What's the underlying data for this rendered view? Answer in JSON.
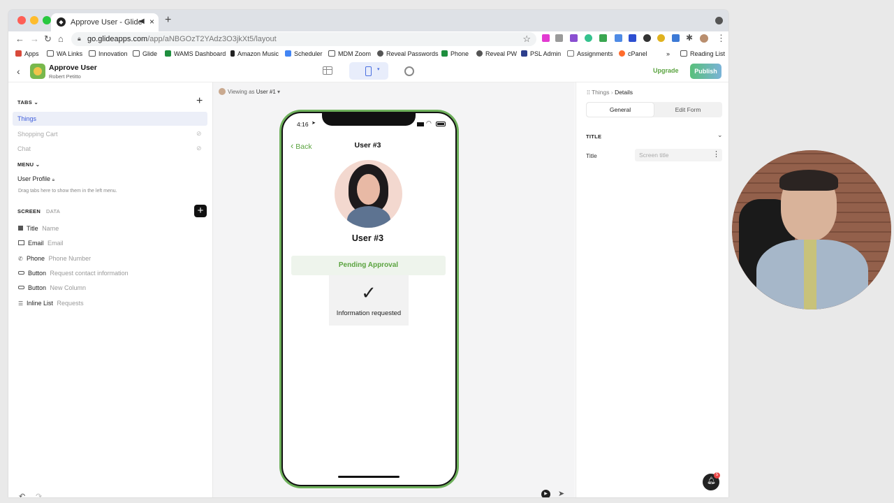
{
  "browser": {
    "tab_title": "Approve User - Glide",
    "url_host": "go.glideapps.com",
    "url_path": "/app/aNBGOzT2YAdz3O3jkXt5/layout",
    "bookmarks": [
      "Apps",
      "WA Links",
      "Innovation",
      "Glide",
      "WAMS Dashboard",
      "Amazon Music",
      "Scheduler",
      "MDM Zoom",
      "Reveal Passwords",
      "Phone",
      "Reveal PW",
      "PSL Admin",
      "Assignments",
      "cPanel"
    ],
    "more": "»",
    "reading_list": "Reading List"
  },
  "app": {
    "name": "Approve User",
    "owner": "Robert Petitto",
    "upgrade": "Upgrade",
    "publish": "Publish"
  },
  "left": {
    "tabs_header": "TABS",
    "tabs": [
      "Things",
      "Shopping Cart",
      "Chat"
    ],
    "menu_header": "MENU",
    "menu_item": "User Profile",
    "menu_hint": "Drag tabs here to show them in the left menu.",
    "screen_tab": "SCREEN",
    "data_tab": "DATA",
    "components": [
      {
        "type": "Title",
        "value": "Name"
      },
      {
        "type": "Email",
        "value": "Email"
      },
      {
        "type": "Phone",
        "value": "Phone Number"
      },
      {
        "type": "Button",
        "value": "Request contact information"
      },
      {
        "type": "Button",
        "value": "New Column"
      },
      {
        "type": "Inline List",
        "value": "Requests"
      }
    ]
  },
  "canvas": {
    "viewing_label": "Viewing as",
    "viewing_user": "User #1",
    "phone": {
      "time": "4:16",
      "back": "Back",
      "header_title": "User #3",
      "profile_name": "User #3",
      "status": "Pending Approval",
      "info": "Information requested"
    }
  },
  "right": {
    "breadcrumb_parent": "Things",
    "breadcrumb_current": "Details",
    "tab_general": "General",
    "tab_edit": "Edit Form",
    "section": "TITLE",
    "field_label": "Title",
    "field_placeholder": "Screen title"
  },
  "notifications": {
    "count": "5"
  },
  "colors": {
    "accent": "#5aa33f",
    "publish": "#6cbf5b",
    "selected": "#eceff8"
  }
}
